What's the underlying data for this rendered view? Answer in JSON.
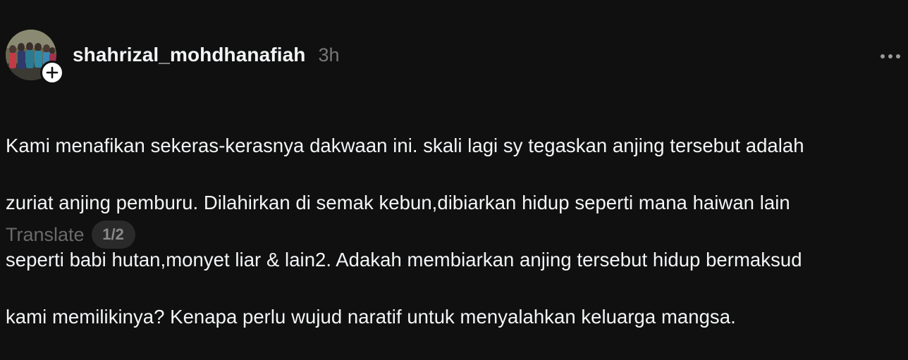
{
  "post": {
    "username": "shahrizal_mohdhanafiah",
    "time": "3h",
    "body_lines": [
      "Kami menafikan sekeras-kerasnya dakwaan ini. skali lagi sy tegaskan anjing tersebut adalah",
      "zuriat anjing pemburu. Dilahirkan di semak kebun,dibiarkan hidup seperti mana haiwan lain",
      "seperti babi hutan,monyet liar & lain2. Adakah membiarkan anjing tersebut hidup bermaksud",
      "kami memilikinya? Kenapa perlu wujud naratif untuk menyalahkan keluarga mangsa."
    ],
    "translate_label": "Translate",
    "pager": "1/2"
  },
  "icons": {
    "avatar": "avatar-photo-group",
    "follow": "plus-icon",
    "more": "more-horizontal-icon"
  },
  "colors": {
    "background": "#101010",
    "primary_text": "#f3f5f7",
    "secondary_text": "#777777",
    "pill_bg": "#2a2a2a"
  }
}
